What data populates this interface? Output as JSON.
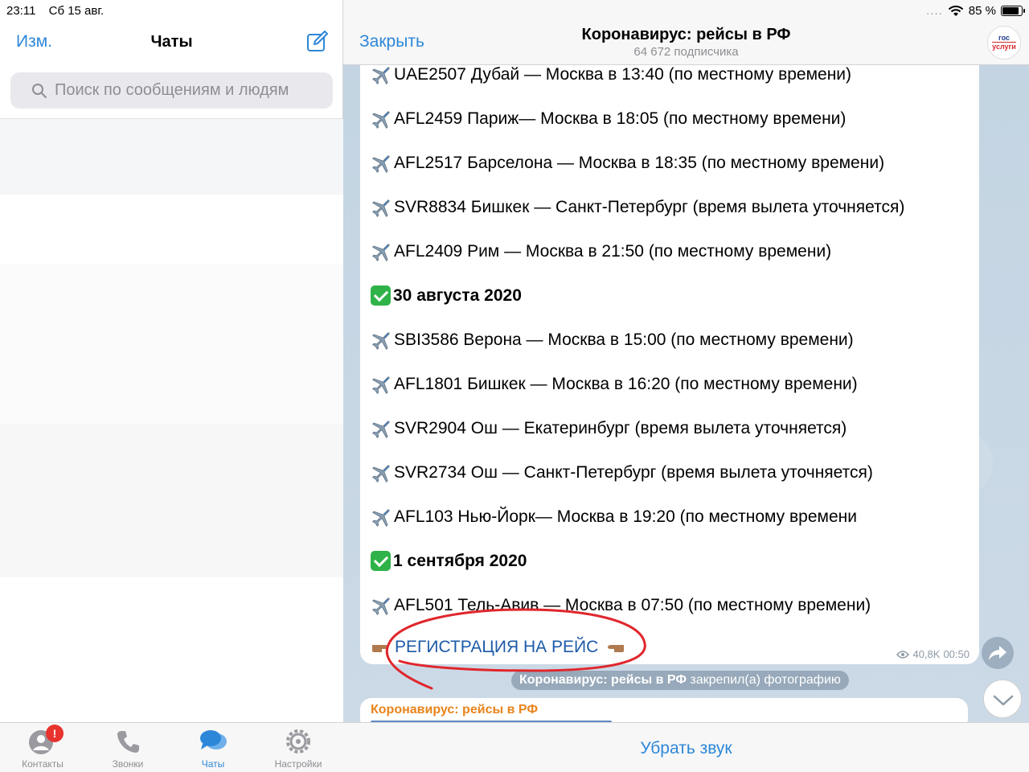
{
  "status_bar": {
    "time": "23:11",
    "date": "Сб 15 авг.",
    "signal": "....",
    "battery": "85 %",
    "battery_level": 0.85
  },
  "left": {
    "edit_label": "Изм.",
    "title": "Чаты",
    "search_placeholder": "Поиск по сообщениям и людям"
  },
  "tabs": [
    {
      "label": "Контакты",
      "icon": "contacts-icon",
      "badge": "!"
    },
    {
      "label": "Звонки",
      "icon": "phone-icon"
    },
    {
      "label": "Чаты",
      "icon": "chats-icon",
      "active": true
    },
    {
      "label": "Настройки",
      "icon": "settings-icon"
    }
  ],
  "right": {
    "close_label": "Закрыть",
    "channel_title": "Коронавирус: рейсы в РФ",
    "channel_subtitle": "64 672 подписчика",
    "avatar_line1": "гос",
    "avatar_line2": "услуги",
    "mute_label": "Убрать звук"
  },
  "message": {
    "lines": [
      {
        "kind": "flight",
        "text": "UAE2507 Дубай — Москва в 13:40 (по местному времени)"
      },
      {
        "kind": "flight",
        "text": "AFL2459 Париж— Москва в 18:05 (по местному времени)"
      },
      {
        "kind": "flight",
        "text": "AFL2517 Барселона — Москва в 18:35 (по местному времени)"
      },
      {
        "kind": "flight",
        "text": "SVR8834 Бишкек — Санкт-Петербург  (время вылета уточняется)"
      },
      {
        "kind": "flight",
        "text": "AFL2409 Рим — Москва в 21:50 (по местному времени)"
      },
      {
        "kind": "date",
        "text": "30 августа 2020"
      },
      {
        "kind": "flight",
        "text": "SBI3586 Верона — Москва  в 15:00 (по местному времени)"
      },
      {
        "kind": "flight",
        "text": "AFL1801 Бишкек — Москва в 16:20 (по местному времени)"
      },
      {
        "kind": "flight",
        "text": "SVR2904 Ош — Екатеринбург  (время вылета уточняется)"
      },
      {
        "kind": "flight",
        "text": "SVR2734 Ош — Санкт-Петербург (время вылета уточняется)"
      },
      {
        "kind": "flight",
        "text": "AFL103 Нью-Йорк— Москва в 19:20 (по местному времени"
      },
      {
        "kind": "date",
        "text": "1 сентября 2020"
      },
      {
        "kind": "flight",
        "text": "AFL501 Тель-Авив — Москва в 07:50 (по местному времени)"
      }
    ],
    "register_link": "РЕГИСТРАЦИЯ НА РЕЙС",
    "views": "40,8K",
    "time": "00:50"
  },
  "pin_notice": {
    "channel": "Коронавирус: рейсы в РФ",
    "action": "закрепил(а) фотографию"
  },
  "next_message": {
    "title": "Коронавирус: рейсы в РФ"
  },
  "colors": {
    "accent": "#2d87d9",
    "link": "#1d5aa8",
    "badge": "#e8332e",
    "check": "#2fb349",
    "annotation": "#e0262c"
  }
}
